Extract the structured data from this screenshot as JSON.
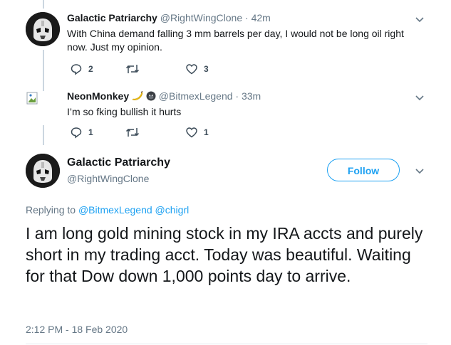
{
  "tweet1": {
    "name": "Galactic Patriarchy",
    "handle": "@RightWingClone",
    "separator": "·",
    "time": "42m",
    "text": "With China demand falling 3 mm barrels per day, I would not be long oil right now. Just my opinion.",
    "replies": "2",
    "retweets": "",
    "likes": "3"
  },
  "tweet2": {
    "name": "NeonMonkey",
    "handle": "@BitmexLegend",
    "separator": "·",
    "time": "33m",
    "text": "I’m so fking bullish it hurts",
    "replies": "1",
    "retweets": "",
    "likes": "1"
  },
  "main_tweet": {
    "name": "Galactic Patriarchy",
    "handle": "@RightWingClone",
    "follow_label": "Follow",
    "replying_prefix": "Replying to",
    "replying_user1": "@BitmexLegend",
    "replying_user2": "@chigrl",
    "text": "I am long gold mining stock in my IRA accts and purely short in my trading acct. Today was beautiful. Waiting for that Dow down 1,000 points day to arrive.",
    "timestamp": "2:12 PM - 18 Feb 2020"
  },
  "colors": {
    "accent": "#1da1f2",
    "secondary_text": "#657786",
    "thread_line": "#cbd6e0"
  }
}
